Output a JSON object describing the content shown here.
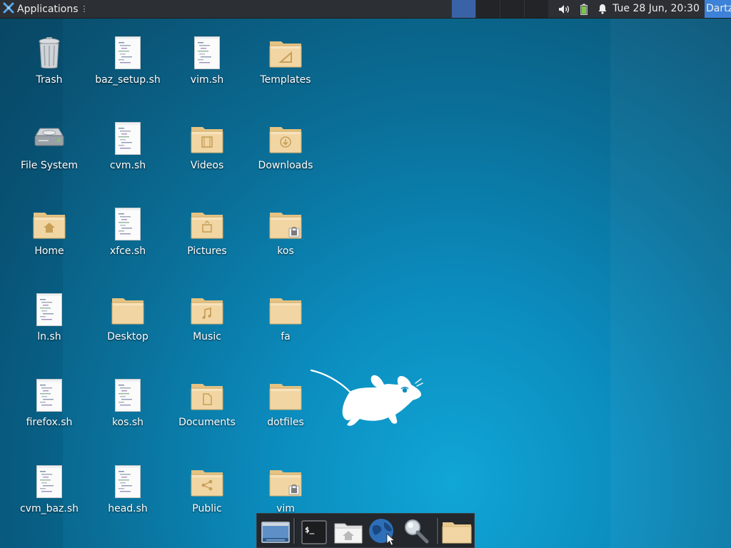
{
  "top_panel": {
    "applications_label": "Applications",
    "clock": "Tue 28 Jun, 20:30",
    "user": "Dartz",
    "icons": {
      "apps": "xfce-logo-icon",
      "volume": "volume-icon",
      "battery": "battery-icon",
      "notifications": "bell-icon"
    },
    "active_workspace": 1,
    "workspace_count": 4
  },
  "desktop": {
    "icons": [
      {
        "label": "Trash",
        "icon": "trash-icon"
      },
      {
        "label": "baz_setup.sh",
        "icon": "script-file-icon"
      },
      {
        "label": "vim.sh",
        "icon": "script-file-icon"
      },
      {
        "label": "Templates",
        "icon": "templates-folder-icon"
      },
      {
        "label": "File System",
        "icon": "hard-drive-icon"
      },
      {
        "label": "cvm.sh",
        "icon": "script-file-icon"
      },
      {
        "label": "Videos",
        "icon": "videos-folder-icon"
      },
      {
        "label": "Downloads",
        "icon": "downloads-folder-icon"
      },
      {
        "label": "Home",
        "icon": "home-folder-icon"
      },
      {
        "label": "xfce.sh",
        "icon": "script-file-icon"
      },
      {
        "label": "Pictures",
        "icon": "pictures-folder-icon"
      },
      {
        "label": "kos",
        "icon": "locked-folder-icon"
      },
      {
        "label": "ln.sh",
        "icon": "script-file-icon"
      },
      {
        "label": "Desktop",
        "icon": "folder-icon"
      },
      {
        "label": "Music",
        "icon": "music-folder-icon"
      },
      {
        "label": "fa",
        "icon": "folder-icon"
      },
      {
        "label": "firefox.sh",
        "icon": "script-file-icon"
      },
      {
        "label": "kos.sh",
        "icon": "script-file-icon"
      },
      {
        "label": "Documents",
        "icon": "documents-folder-icon"
      },
      {
        "label": "dotfiles",
        "icon": "folder-icon"
      },
      {
        "label": "cvm_baz.sh",
        "icon": "script-file-icon"
      },
      {
        "label": "head.sh",
        "icon": "script-file-icon"
      },
      {
        "label": "Public",
        "icon": "public-folder-icon"
      },
      {
        "label": "vim",
        "icon": "locked-folder-icon"
      }
    ],
    "wallpaper_mascot": "xfce-mouse-icon"
  },
  "dock": {
    "items": [
      {
        "icon": "show-desktop-icon"
      },
      {
        "icon": "terminal-icon",
        "terminal_glyph": "$_"
      },
      {
        "icon": "home-folder-icon"
      },
      {
        "icon": "web-browser-icon"
      },
      {
        "icon": "search-icon"
      },
      {
        "icon": "folder-icon"
      }
    ]
  },
  "colors": {
    "panel": "#2c2f33",
    "active_workspace": "#3a62a6",
    "user_button": "#3d82d8",
    "folder": "#f1d6a4",
    "wallpaper": "#0b8cbe"
  }
}
